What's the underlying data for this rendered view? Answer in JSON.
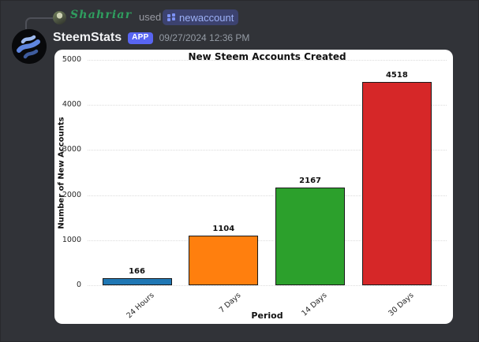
{
  "discord": {
    "reply": {
      "username": "Shahriar",
      "action_text": "used",
      "command_name": "newaccount"
    },
    "message": {
      "bot_name": "SteemStats",
      "app_badge_label": "APP",
      "timestamp": "09/27/2024 12:36 PM"
    },
    "colors": {
      "background": "#313338",
      "username_green": "#2f9e5f",
      "app_badge_blurple": "#5865f2",
      "command_chip_bg": "#3c426f",
      "command_text_blue": "#9db1f7",
      "timestamp_gray": "#949ba4",
      "bot_name_white": "#f2f3f5",
      "reply_spine_gray": "#4e5058"
    },
    "icons": {
      "reply_user_avatar": "circular user photo",
      "bot_avatar": "steemstats-logo (black circle, three blue wavy stripes)",
      "command_icon": "slash-command grid of four blue squares"
    }
  },
  "chart_data": {
    "type": "bar",
    "title": "New Steem Accounts Created",
    "xlabel": "Period",
    "ylabel": "Number of New Accounts",
    "categories": [
      "24 Hours",
      "7 Days",
      "14 Days",
      "30 Days"
    ],
    "values": [
      166,
      1104,
      2167,
      4518
    ],
    "value_labels": [
      "166",
      "1104",
      "2167",
      "4518"
    ],
    "bar_colors": [
      "#1f77b4",
      "#ff7f0e",
      "#2ca02c",
      "#d62728"
    ],
    "bar_edge_color": "#1a1a1a",
    "ylim": [
      0,
      5000
    ],
    "yticks": [
      0,
      1000,
      2000,
      3000,
      4000,
      5000
    ],
    "grid": "horizontal dotted light-gray",
    "legend": "none",
    "plot_background": "#ffffff",
    "xtick_rotation_degrees": 45
  }
}
